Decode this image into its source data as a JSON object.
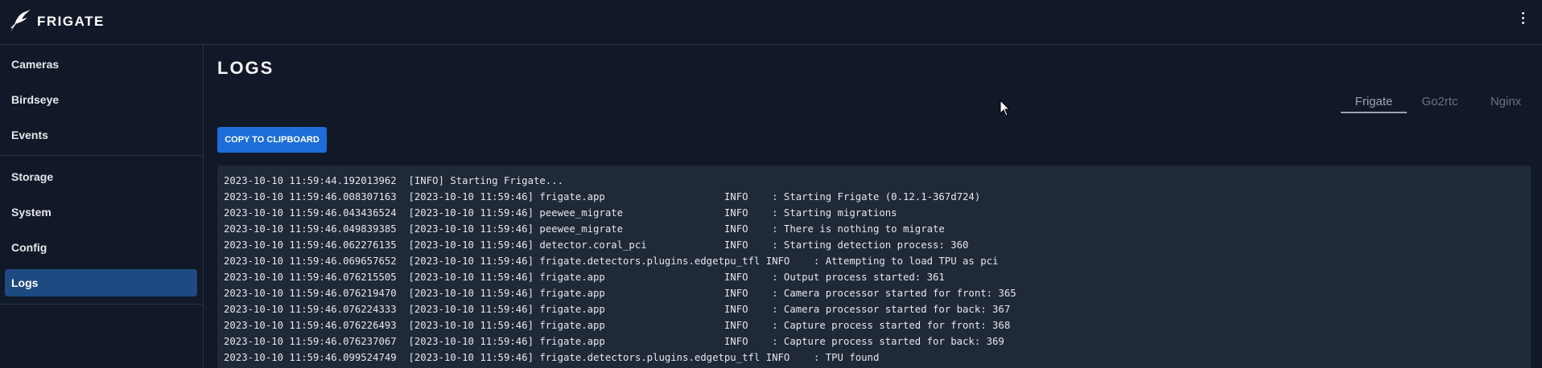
{
  "header": {
    "brand": "FRIGATE"
  },
  "sidebar": {
    "items": [
      {
        "label": "Cameras",
        "active": false
      },
      {
        "label": "Birdseye",
        "active": false
      },
      {
        "label": "Events",
        "active": false
      },
      {
        "label": "Storage",
        "active": false
      },
      {
        "label": "System",
        "active": false
      },
      {
        "label": "Config",
        "active": false
      },
      {
        "label": "Logs",
        "active": true
      }
    ]
  },
  "main": {
    "title": "LOGS",
    "tabs": [
      {
        "label": "Frigate",
        "active": true
      },
      {
        "label": "Go2rtc",
        "active": false
      },
      {
        "label": "Nginx",
        "active": false
      }
    ],
    "copy_button": "COPY TO CLIPBOARD",
    "log_lines": [
      "2023-10-10 11:59:44.192013962  [INFO] Starting Frigate...",
      "2023-10-10 11:59:46.008307163  [2023-10-10 11:59:46] frigate.app                    INFO    : Starting Frigate (0.12.1-367d724)",
      "2023-10-10 11:59:46.043436524  [2023-10-10 11:59:46] peewee_migrate                 INFO    : Starting migrations",
      "2023-10-10 11:59:46.049839385  [2023-10-10 11:59:46] peewee_migrate                 INFO    : There is nothing to migrate",
      "2023-10-10 11:59:46.062276135  [2023-10-10 11:59:46] detector.coral_pci             INFO    : Starting detection process: 360",
      "2023-10-10 11:59:46.069657652  [2023-10-10 11:59:46] frigate.detectors.plugins.edgetpu_tfl INFO    : Attempting to load TPU as pci",
      "2023-10-10 11:59:46.076215505  [2023-10-10 11:59:46] frigate.app                    INFO    : Output process started: 361",
      "2023-10-10 11:59:46.076219470  [2023-10-10 11:59:46] frigate.app                    INFO    : Camera processor started for front: 365",
      "2023-10-10 11:59:46.076224333  [2023-10-10 11:59:46] frigate.app                    INFO    : Camera processor started for back: 367",
      "2023-10-10 11:59:46.076226493  [2023-10-10 11:59:46] frigate.app                    INFO    : Capture process started for front: 368",
      "2023-10-10 11:59:46.076237067  [2023-10-10 11:59:46] frigate.app                    INFO    : Capture process started for back: 369",
      "2023-10-10 11:59:46.099524749  [2023-10-10 11:59:46] frigate.detectors.plugins.edgetpu_tfl INFO    : TPU found"
    ]
  },
  "colors": {
    "background": "#111827",
    "accent": "#1d6ed8",
    "active_nav": "#1e4a82",
    "log_panel": "#1f2937"
  },
  "icons": {
    "logo": "frigate-bird-logo",
    "menu": "vertical-dots-icon"
  }
}
